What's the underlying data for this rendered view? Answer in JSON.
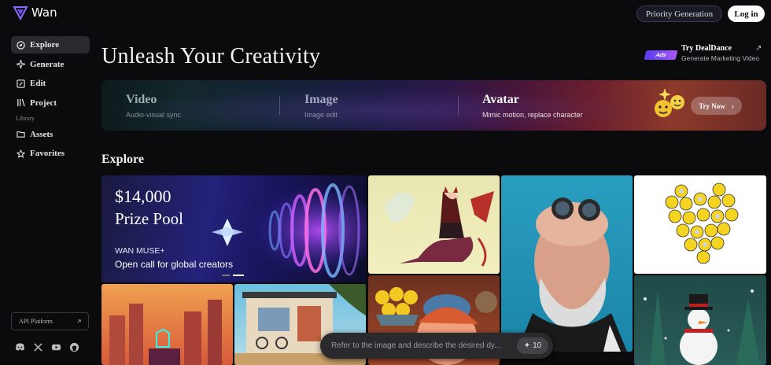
{
  "app": {
    "name": "Wan"
  },
  "sidebar": {
    "items": [
      {
        "label": "Explore",
        "icon": "compass-icon",
        "active": true
      },
      {
        "label": "Generate",
        "icon": "sparkle-icon",
        "active": false
      },
      {
        "label": "Edit",
        "icon": "edit-icon",
        "active": false
      },
      {
        "label": "Project",
        "icon": "library-icon",
        "active": false
      }
    ],
    "section_label": "Library",
    "library_items": [
      {
        "label": "Assets",
        "icon": "folder-icon"
      },
      {
        "label": "Favorites",
        "icon": "star-icon"
      }
    ],
    "api_label": "API Platform",
    "socials": [
      "discord-icon",
      "x-icon",
      "youtube-icon",
      "github-icon"
    ]
  },
  "topbar": {
    "priority_label": "Priority Generation",
    "login_label": "Log in"
  },
  "hero": {
    "headline": "Unleash Your Creativity"
  },
  "ad": {
    "badge": "Ads",
    "title": "Try DealDance",
    "subtitle": "Generate Marketing Video"
  },
  "banner": {
    "cells": [
      {
        "title": "Video",
        "subtitle": "Audio-visual sync"
      },
      {
        "title": "Image",
        "subtitle": "Image edit"
      },
      {
        "title": "Avatar",
        "subtitle": "Mimic motion, replace character"
      }
    ],
    "cta": "Try Now"
  },
  "explore": {
    "title": "Explore",
    "prize": {
      "amount": "$14,000",
      "pool": "Prize Pool",
      "brand": "WAN MUSE+",
      "call": "Open call for global creators"
    }
  },
  "prompt": {
    "placeholder": "Refer to the image and describe the desired dy...",
    "credits": "10"
  },
  "colors": {
    "accent": "#6c4cf5",
    "background": "#0b0b0d"
  }
}
